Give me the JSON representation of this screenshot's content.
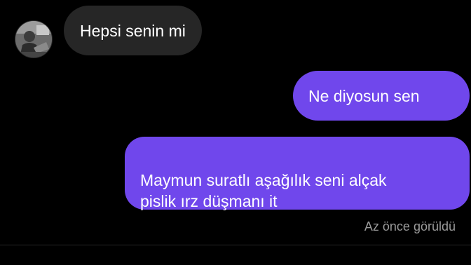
{
  "conversation": {
    "incoming": [
      {
        "text": "Hepsi senin mi"
      }
    ],
    "outgoing": [
      {
        "text": "Ne diyosun sen"
      },
      {
        "text": "Maymun suratlı aşağılık seni alçak\npislik ırz düşmanı it"
      }
    ],
    "read_receipt": "Az önce görüldü"
  },
  "colors": {
    "background": "#000000",
    "incoming_bubble": "#262626",
    "outgoing_bubble": "#7047ec",
    "receipt_text": "#9a9a9a"
  },
  "icons": {
    "avatar": "profile-photo"
  }
}
